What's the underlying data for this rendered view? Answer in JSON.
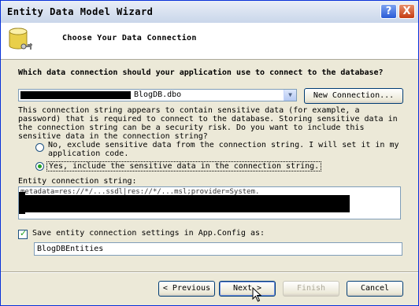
{
  "window": {
    "title": "Entity Data Model Wizard",
    "help_glyph": "?",
    "close_glyph": "X"
  },
  "header": {
    "title": "Choose Your Data Connection",
    "icon": "database-icon"
  },
  "question": "Which data connection should your application use to connect to the database?",
  "connection": {
    "selected": "BlogDB.dbo",
    "new_button": "New Connection..."
  },
  "warning": "This connection string appears to contain sensitive data (for example, a password) that is required to connect to the database. Storing sensitive data in the connection string can be a security risk. Do you want to include this sensitive data in the connection string?",
  "options": {
    "exclude": "No, exclude sensitive data from the connection string. I will set it in my application code.",
    "include": "Yes, include the sensitive data in the connection string.",
    "selected": "include"
  },
  "entity_conn": {
    "label": "Entity connection string:",
    "visible_text": "metadata=res://*/...ssdl|res://*/...msl;provider=System."
  },
  "save": {
    "checked": true,
    "label": "Save entity connection settings in App.Config as:",
    "value": "BlogDBEntities"
  },
  "buttons": {
    "previous": "< Previous",
    "next": "Next >",
    "finish": "Finish",
    "cancel": "Cancel"
  }
}
